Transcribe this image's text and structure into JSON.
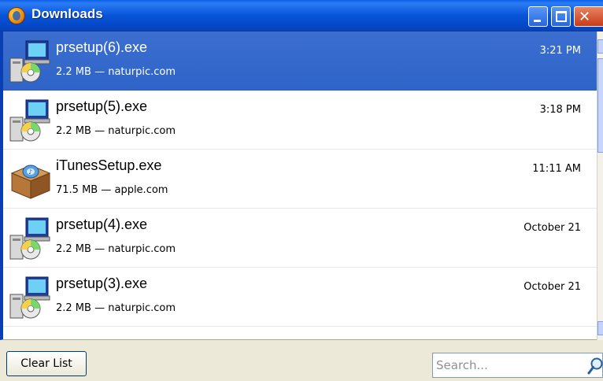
{
  "window": {
    "title": "Downloads"
  },
  "downloads": [
    {
      "name": "prsetup(6).exe",
      "meta": "2.2 MB — naturpic.com",
      "time": "3:21 PM",
      "icon": "installer-icon",
      "selected": true
    },
    {
      "name": "prsetup(5).exe",
      "meta": "2.2 MB — naturpic.com",
      "time": "3:18 PM",
      "icon": "installer-icon",
      "selected": false
    },
    {
      "name": "iTunesSetup.exe",
      "meta": "71.5 MB — apple.com",
      "time": "11:11 AM",
      "icon": "package-icon",
      "selected": false
    },
    {
      "name": "prsetup(4).exe",
      "meta": "2.2 MB — naturpic.com",
      "time": "October 21",
      "icon": "installer-icon",
      "selected": false
    },
    {
      "name": "prsetup(3).exe",
      "meta": "2.2 MB — naturpic.com",
      "time": "October 21",
      "icon": "installer-icon",
      "selected": false
    }
  ],
  "footer": {
    "clear_label": "Clear List",
    "search_placeholder": "Search..."
  },
  "colors": {
    "titlebar": "#0854d8",
    "selection": "#316ac5",
    "chrome": "#ece9d8"
  }
}
